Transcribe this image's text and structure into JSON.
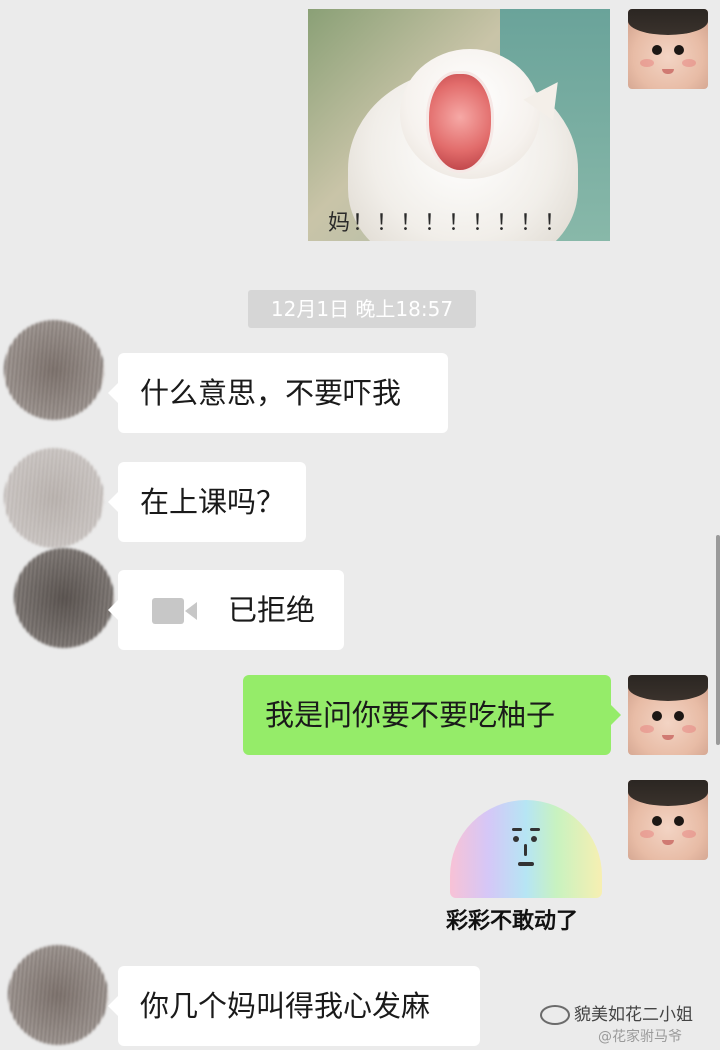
{
  "image_message": {
    "caption": "妈！！！！！！！！！"
  },
  "timestamp": "12月1日 晚上18:57",
  "messages": [
    {
      "text": "什么意思，不要吓我"
    },
    {
      "text": "在上课吗？"
    },
    {
      "text": "已拒绝",
      "icon": "video-call-icon"
    },
    {
      "text": "我是问你要不要吃柚子"
    },
    {
      "text": "你几个妈叫得我心发麻"
    }
  ],
  "sticker": {
    "caption": "彩彩不敢动了"
  },
  "watermark": {
    "primary": "貌美如花二小姐",
    "secondary": "@花家驸马爷"
  },
  "colors": {
    "background": "#ebebeb",
    "incoming_bubble": "#ffffff",
    "outgoing_bubble": "#95ec69",
    "timestamp_bg": "#d6d6d6"
  }
}
